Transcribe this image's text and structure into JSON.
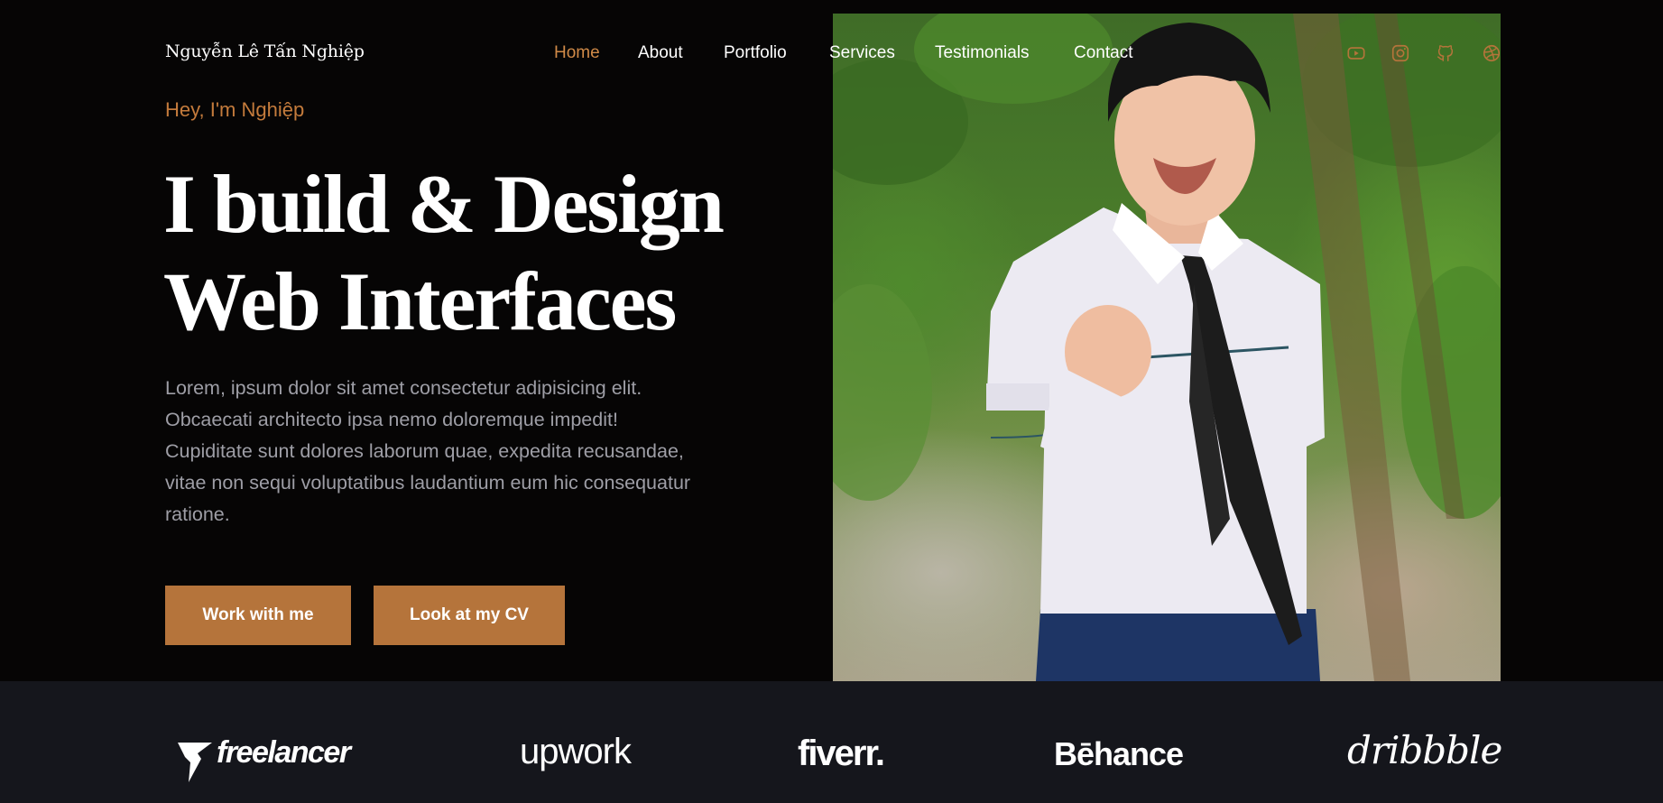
{
  "brand": {
    "name": "Nguyễn Lê Tấn Nghiệp"
  },
  "nav": {
    "items": [
      {
        "label": "Home",
        "active": true
      },
      {
        "label": "About",
        "active": false
      },
      {
        "label": "Portfolio",
        "active": false
      },
      {
        "label": "Services",
        "active": false
      },
      {
        "label": "Testimonials",
        "active": false
      },
      {
        "label": "Contact",
        "active": false
      }
    ]
  },
  "social": [
    "youtube-icon",
    "instagram-icon",
    "github-icon",
    "dribbble-icon"
  ],
  "hero": {
    "greeting": "Hey, I'm Nghiệp",
    "headline_line1": "I build & Design",
    "headline_line2": "Web Interfaces",
    "intro": "Lorem, ipsum dolor sit amet consectetur adipisicing elit. Obcaecati architecto ipsa nemo doloremque impedit! Cupiditate sunt dolores laborum quae, expedita recusandae, vitae non sequi voluptatibus laudantium eum hic consequatur ratione.",
    "primary_button": "Work with me",
    "secondary_button": "Look at my CV"
  },
  "partners": [
    "freelancer",
    "upwork",
    "fiverr.",
    "Bēhance",
    "dribbble"
  ],
  "colors": {
    "accent": "#b5743b",
    "accent_text": "#c47b3c",
    "background": "#060505",
    "partner_bar": "#15161c"
  }
}
